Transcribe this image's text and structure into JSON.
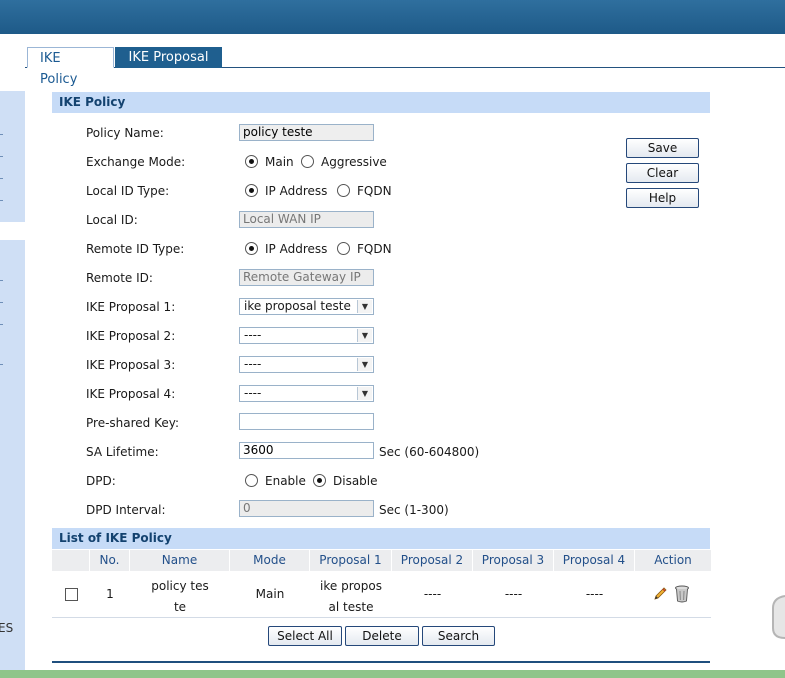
{
  "tabs": [
    {
      "label": "IKE Policy"
    },
    {
      "label": "IKE Proposal"
    }
  ],
  "form": {
    "section_title": "IKE Policy",
    "policy_name": {
      "label": "Policy Name:",
      "value": "policy teste"
    },
    "exchange_mode": {
      "label": "Exchange Mode:",
      "options": [
        "Main",
        "Aggressive"
      ],
      "selected": "Main"
    },
    "local_id_type": {
      "label": "Local ID Type:",
      "options": [
        "IP Address",
        "FQDN"
      ],
      "selected": "IP Address"
    },
    "local_id": {
      "label": "Local ID:",
      "value": "Local WAN IP"
    },
    "remote_id_type": {
      "label": "Remote ID Type:",
      "options": [
        "IP Address",
        "FQDN"
      ],
      "selected": "IP Address"
    },
    "remote_id": {
      "label": "Remote ID:",
      "value": "Remote Gateway IP"
    },
    "ike_proposal_1": {
      "label": "IKE Proposal 1:",
      "value": "ike proposal teste"
    },
    "ike_proposal_2": {
      "label": "IKE Proposal 2:",
      "value": "----"
    },
    "ike_proposal_3": {
      "label": "IKE Proposal 3:",
      "value": "----"
    },
    "ike_proposal_4": {
      "label": "IKE Proposal 4:",
      "value": "----"
    },
    "pre_shared_key": {
      "label": "Pre-shared Key:",
      "value": ""
    },
    "sa_lifetime": {
      "label": "SA Lifetime:",
      "value": "3600",
      "unit": "Sec (60-604800)"
    },
    "dpd": {
      "label": "DPD:",
      "options": [
        "Enable",
        "Disable"
      ],
      "selected": "Disable"
    },
    "dpd_interval": {
      "label": "DPD Interval:",
      "value": "0",
      "unit": "Sec (1-300)"
    }
  },
  "side_buttons": {
    "save": "Save",
    "clear": "Clear",
    "help": "Help"
  },
  "list": {
    "title": "List of IKE Policy",
    "columns": [
      "No.",
      "Name",
      "Mode",
      "Proposal 1",
      "Proposal 2",
      "Proposal 3",
      "Proposal 4",
      "Action"
    ],
    "rows": [
      {
        "no": "1",
        "name_line1": "policy tes",
        "name_line2": "te",
        "mode": "Main",
        "p1_line1": "ike propos",
        "p1_line2": "al teste",
        "p2": "----",
        "p3": "----",
        "p4": "----"
      }
    ]
  },
  "bottom_buttons": {
    "select_all": "Select All",
    "delete": "Delete",
    "search": "Search"
  },
  "left_nav": {
    "partial_text": "ES"
  },
  "icons": {
    "edit": "pencil-icon",
    "delete": "trash-icon",
    "radio": "radio-button"
  }
}
